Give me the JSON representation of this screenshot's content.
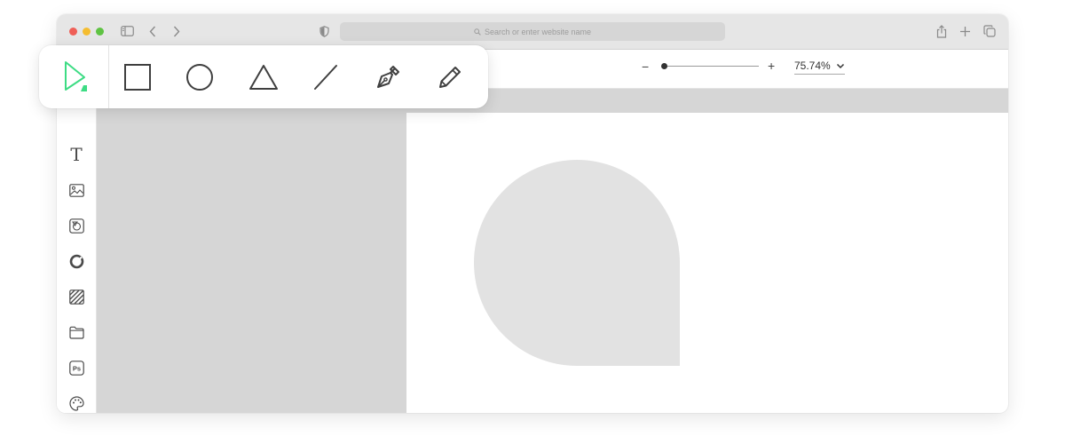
{
  "browser": {
    "url_placeholder": "Search or enter website name",
    "traffic_lights": [
      "#ef5f57",
      "#f5bd30",
      "#5fc343"
    ],
    "icons": [
      "sidebar-toggle-icon",
      "back-icon",
      "forward-icon",
      "shield-icon",
      "share-icon",
      "new-tab-icon",
      "tabs-overview-icon"
    ]
  },
  "zoom": {
    "minus_label": "−",
    "plus_label": "+",
    "value": "75.74%",
    "slider_fraction": 0.0
  },
  "toolbar": {
    "accent_color": "#3ddc84",
    "tools": [
      {
        "name": "select-tool",
        "icon": "pointer-arrow-icon",
        "active": true
      },
      {
        "name": "rectangle-tool",
        "icon": "square-icon"
      },
      {
        "name": "ellipse-tool",
        "icon": "circle-icon"
      },
      {
        "name": "triangle-tool",
        "icon": "triangle-icon"
      },
      {
        "name": "line-tool",
        "icon": "line-icon"
      },
      {
        "name": "pen-tool",
        "icon": "pen-nib-icon"
      },
      {
        "name": "pencil-tool",
        "icon": "pencil-icon"
      }
    ]
  },
  "sidebar": {
    "tools": [
      {
        "name": "text-tool",
        "glyph": "T"
      },
      {
        "name": "image-tool",
        "icon": "image-icon"
      },
      {
        "name": "sticker-tool",
        "icon": "sticker-icon"
      },
      {
        "name": "color-ring-tool",
        "icon": "ring-icon"
      },
      {
        "name": "pattern-tool",
        "icon": "hatch-icon"
      },
      {
        "name": "folder-tool",
        "icon": "folder-icon"
      },
      {
        "name": "photoshop-import-tool",
        "icon": "ps-file-icon",
        "label": "Ps"
      },
      {
        "name": "palette-tool",
        "icon": "palette-icon"
      }
    ]
  },
  "canvas": {
    "workspace_color": "#d6d6d6",
    "artboard_color": "#ffffff",
    "shape_color": "#e2e2e2"
  }
}
